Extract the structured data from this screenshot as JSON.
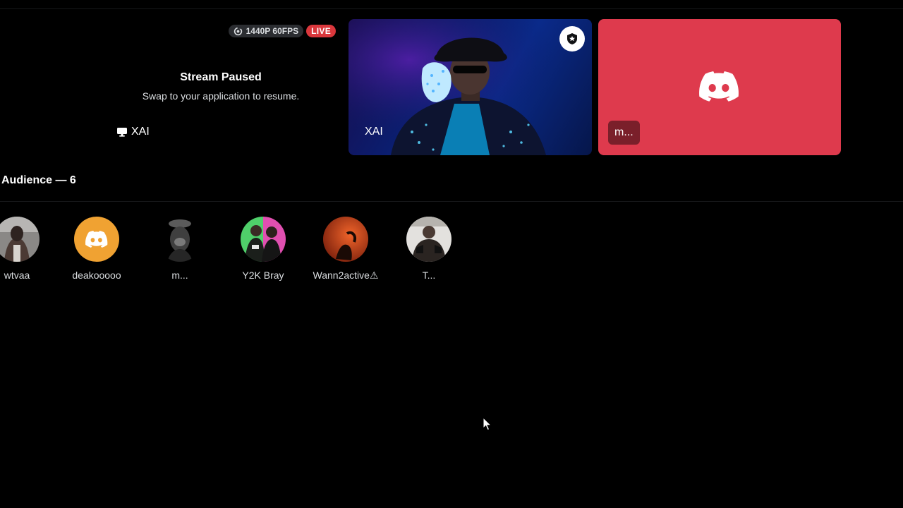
{
  "stream": {
    "quality_label": "1440P 60FPS",
    "live_label": "LIVE",
    "paused_title": "Stream Paused",
    "paused_subtitle": "Swap to your application to resume.",
    "screen_share_user": "XAI"
  },
  "camera_tile": {
    "user": "XAI"
  },
  "avatar_tile": {
    "user": "m...",
    "color": "#de3a4d"
  },
  "audience": {
    "header": "Audience — 6",
    "members": [
      {
        "name": "wtvaa"
      },
      {
        "name": "deakooooo",
        "avatar_color": "#f0a232"
      },
      {
        "name": "m..."
      },
      {
        "name": "Y2K Bray"
      },
      {
        "name": "Wann2active⚠"
      },
      {
        "name": "T..."
      }
    ]
  },
  "colors": {
    "background": "#000000",
    "live_red": "#da373c",
    "badge_gray": "#2b2d31"
  }
}
